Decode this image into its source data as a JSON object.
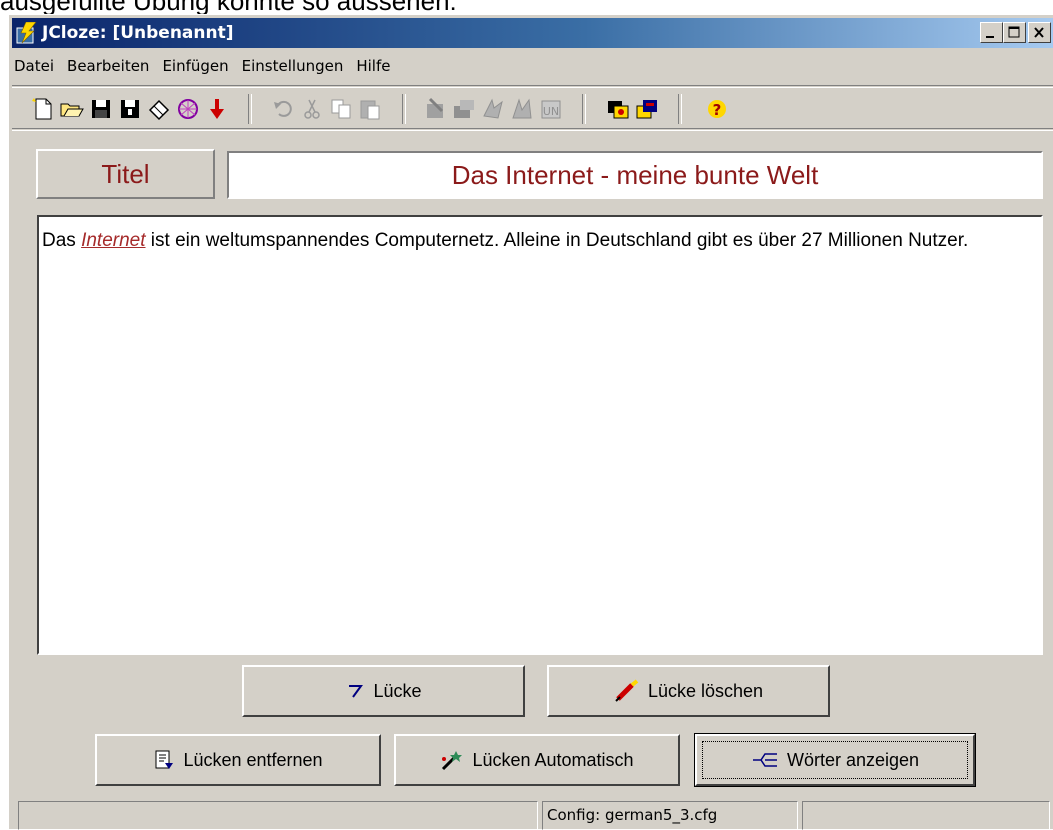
{
  "doc_caption": "ausgefüllte Übung könnte so aussehen:",
  "window": {
    "title": "JCloze: [Unbenannt]"
  },
  "menu": [
    "Datei",
    "Bearbeiten",
    "Einfügen",
    "Einstellungen",
    "Hilfe"
  ],
  "toolbar_icons": [
    "new-file-icon",
    "open-folder-icon",
    "save-icon",
    "save-as-icon",
    "eraser-icon",
    "web-export-icon",
    "arrow-down-icon",
    "undo-icon",
    "cut-icon",
    "copy-icon",
    "paste-icon",
    "tool-icon-1",
    "tool-icon-2",
    "tool-icon-3",
    "tool-icon-4",
    "tool-icon-5",
    "tool-icon-6",
    "tool-icon-7",
    "help-icon"
  ],
  "title_label": "Titel",
  "title_value": "Das Internet - meine bunte Welt",
  "editor": {
    "before": "Das ",
    "gap_word": "Internet",
    "after": " ist ein weltumspannendes Computernetz. Alleine in Deutschland gibt es über 27 Millionen Nutzer."
  },
  "buttons": {
    "gap": "Lücke",
    "delete_gap": "Lücke löschen",
    "remove_gaps": "Lücken entfernen",
    "auto_gaps": "Lücken Automatisch",
    "show_words": "Wörter anzeigen"
  },
  "status": {
    "config": "Config: german5_3.cfg"
  },
  "colors": {
    "title_text": "#8b1a1a",
    "gap_word": "#a52a2a",
    "titlebar_start": "#0a246a"
  }
}
